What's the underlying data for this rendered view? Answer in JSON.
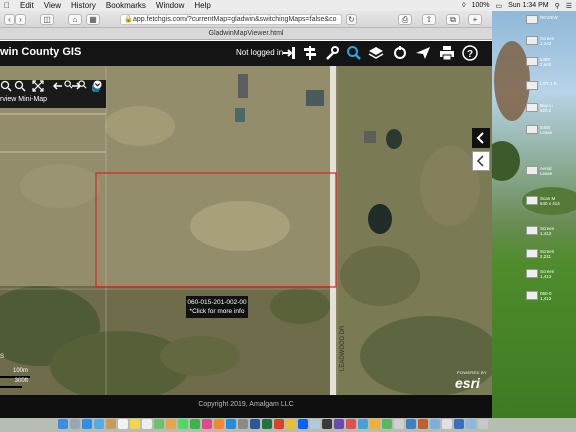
{
  "menubar": {
    "items": [
      "Edit",
      "View",
      "History",
      "Bookmarks",
      "Window",
      "Help"
    ],
    "battery": "100%",
    "clock": "Sun 1:34 PM"
  },
  "browser": {
    "url": "app.fetchgis.com/?currentMap=gladwin&switchingMaps=false&co",
    "tab_title": "GladwinMapViewer.html"
  },
  "gis": {
    "title": "win County GIS",
    "login_status": "Not logged in",
    "overview_label": "rview Mini-Map",
    "popup_parcel": "060-015-201-002-00",
    "popup_hint": "*Click for more info",
    "road_label": "LEADWOOD DR",
    "scale_metric": "100m",
    "scale_imperial": "300ft",
    "scale_side": "S",
    "esri_powered": "POWERED BY",
    "esri_logo": "esri",
    "footer": "Copyright 2019, Amalgam LLC"
  },
  "desktop_files": [
    {
      "label": "REVIEW",
      "size": ""
    },
    {
      "label": "Screen",
      "size": "1,242"
    },
    {
      "label": "5485",
      "size": "2,660"
    },
    {
      "label": "LOT 1 E",
      "size": ""
    },
    {
      "label": "Buy-Li",
      "size": "620.2"
    },
    {
      "label": "5485",
      "size": "Lease"
    },
    {
      "label": "Aerial",
      "size": "Lease"
    },
    {
      "label": "Scan M",
      "size": "640 x 414"
    },
    {
      "label": "Screen",
      "size": "1,413"
    },
    {
      "label": "Screen",
      "size": "2,211"
    },
    {
      "label": "Screen",
      "size": "1,413"
    },
    {
      "label": "060-0",
      "size": "1,413"
    }
  ],
  "colors": {
    "header_bg": "#141414",
    "parcel_outline": "#e02020",
    "accent_search": "#2aa3e0"
  }
}
